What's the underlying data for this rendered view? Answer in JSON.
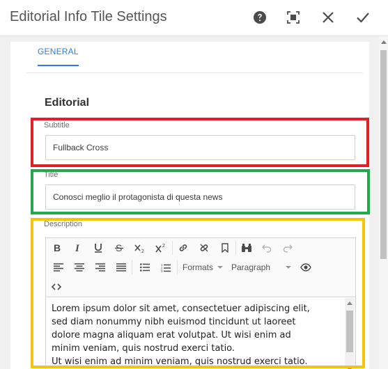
{
  "dialog": {
    "title": "Editorial Info Tile Settings"
  },
  "header_actions": [
    {
      "name": "help-icon"
    },
    {
      "name": "fullscreen-icon"
    },
    {
      "name": "close-icon"
    },
    {
      "name": "done-check-icon"
    }
  ],
  "tabs": [
    {
      "label": "GENERAL",
      "active": true
    }
  ],
  "section": {
    "heading": "Editorial"
  },
  "fields": {
    "subtitle": {
      "label": "Subtitle",
      "value": "Fullback Cross"
    },
    "title": {
      "label": "Title",
      "value": "Conosci meglio il protagonista di questa news"
    },
    "description": {
      "label": "Description",
      "text": "Lorem ipsum dolor sit amet, consectetuer adipiscing elit,\nsed diam nonummy nibh euismod tincidunt ut laoreet\ndolore magna aliquam erat volutpat. Ut wisi enim ad\nminim veniam, quis nostrud exerci tatio.\nUt wisi enim ad minim veniam, quis nostrud exerci tatio."
    }
  },
  "rte_toolbar": {
    "row1": [
      "bold-icon",
      "italic-icon",
      "underline-icon",
      "strikethrough-icon",
      "subscript-icon",
      "superscript-icon",
      "link-icon",
      "unlink-icon",
      "anchor-icon",
      "find-replace-icon",
      "undo-icon",
      "redo-icon"
    ],
    "row2": [
      "align-left-icon",
      "align-center-icon",
      "align-right-icon",
      "align-justify-icon",
      "bullet-list-icon",
      "numbered-list-icon",
      "formats-dropdown",
      "paragraph-dropdown",
      "preview-eye-icon"
    ],
    "row3": [
      "source-edit-icon"
    ],
    "formats_label": "Formats",
    "paragraph_label": "Paragraph"
  },
  "colors": {
    "accent": "#2680eb",
    "highlight_red": "#e31e24",
    "highlight_green": "#22a94a",
    "highlight_yellow": "#f6c40c"
  }
}
